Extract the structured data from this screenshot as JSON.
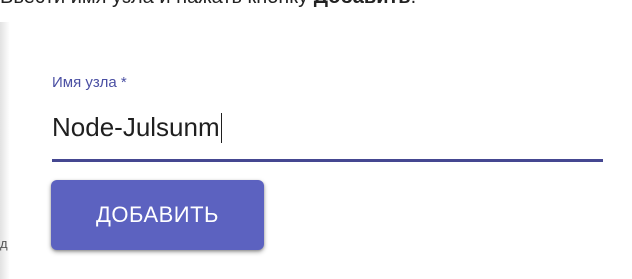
{
  "instruction": {
    "prefix": "Ввести имя узла и нажать кнопку ",
    "bold": "Добавить",
    "suffix": "."
  },
  "form": {
    "node_name_label": "Имя узла *",
    "node_name_value": "Node-Julsunm"
  },
  "actions": {
    "add_label": "ДОБАВИТЬ"
  },
  "side_text": "д",
  "colors": {
    "accent": "#5c62c0",
    "label": "#4a4fa3",
    "underline": "#454791"
  }
}
